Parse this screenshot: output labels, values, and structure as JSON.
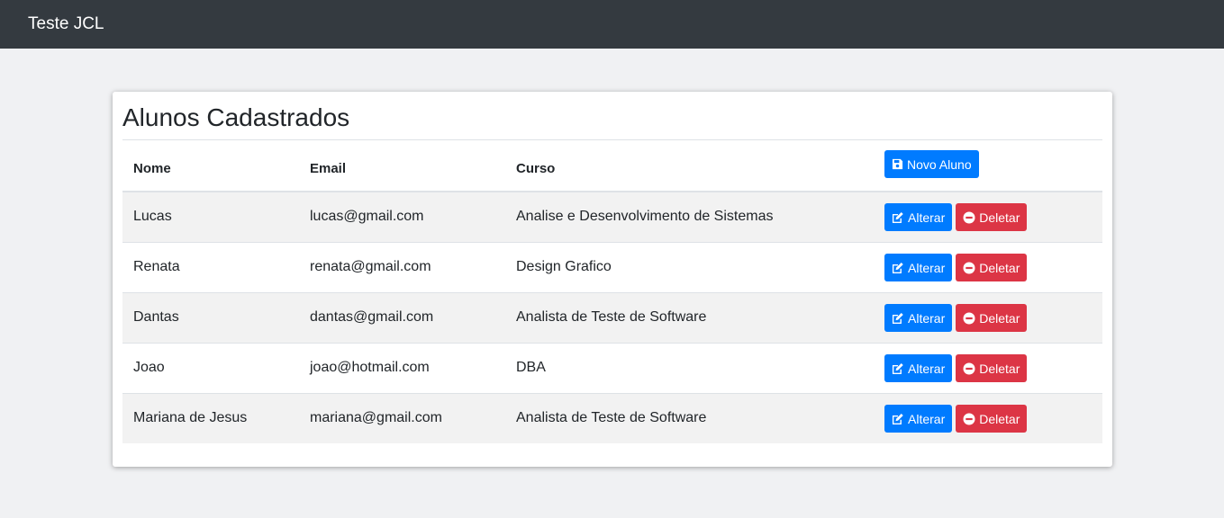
{
  "navbar": {
    "brand": "Teste JCL"
  },
  "page": {
    "title": "Alunos Cadastrados"
  },
  "table": {
    "headers": {
      "name": "Nome",
      "email": "Email",
      "course": "Curso"
    },
    "new_button_label": "Novo Aluno",
    "edit_label": "Alterar",
    "delete_label": "Deletar",
    "rows": [
      {
        "name": "Lucas",
        "email": "lucas@gmail.com",
        "course": "Analise e Desenvolvimento de Sistemas"
      },
      {
        "name": "Renata",
        "email": "renata@gmail.com",
        "course": "Design Grafico"
      },
      {
        "name": "Dantas",
        "email": "dantas@gmail.com",
        "course": "Analista de Teste de Software"
      },
      {
        "name": "Joao",
        "email": "joao@hotmail.com",
        "course": "DBA"
      },
      {
        "name": "Mariana de Jesus",
        "email": "mariana@gmail.com",
        "course": "Analista de Teste de Software"
      }
    ]
  },
  "icons": {
    "new": "save-icon",
    "edit": "edit-icon",
    "delete": "minus-circle-icon"
  },
  "colors": {
    "navbar": "#343a40",
    "primary": "#007bff",
    "danger": "#dc3545",
    "stripe": "#f2f2f2"
  }
}
